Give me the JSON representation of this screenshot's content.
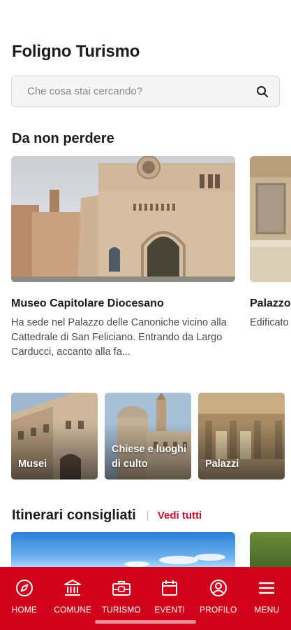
{
  "app": {
    "title": "Foligno Turismo"
  },
  "search": {
    "placeholder": "Che cosa stai cercando?",
    "icon": "search-icon"
  },
  "highlights": {
    "title": "Da non perdere",
    "cards": [
      {
        "title": "Museo Capitolare Diocesano",
        "description": "Ha sede nel Palazzo delle Canoniche vicino alla Cattedrale di San Feliciano. Entrando da Largo Carducci, accanto alla fa..."
      },
      {
        "title": "Palazzo Quintan",
        "description": "Edificato divenne oggi app"
      }
    ]
  },
  "categories": [
    {
      "label": "Musei"
    },
    {
      "label": "Chiese e luoghi di culto"
    },
    {
      "label": "Palazzi"
    }
  ],
  "itineraries": {
    "title": "Itinerari consigliati",
    "see_all": "Vedi tutti"
  },
  "tabbar": {
    "items": [
      {
        "label": "HOME",
        "icon": "compass-icon"
      },
      {
        "label": "COMUNE",
        "icon": "town-hall-icon"
      },
      {
        "label": "TURISMO",
        "icon": "luggage-icon"
      },
      {
        "label": "EVENTI",
        "icon": "calendar-icon"
      },
      {
        "label": "PROFILO",
        "icon": "user-icon"
      },
      {
        "label": "MENU",
        "icon": "hamburger-icon"
      }
    ]
  },
  "colors": {
    "accent": "#c8102e",
    "tabbar": "#d0021b"
  }
}
